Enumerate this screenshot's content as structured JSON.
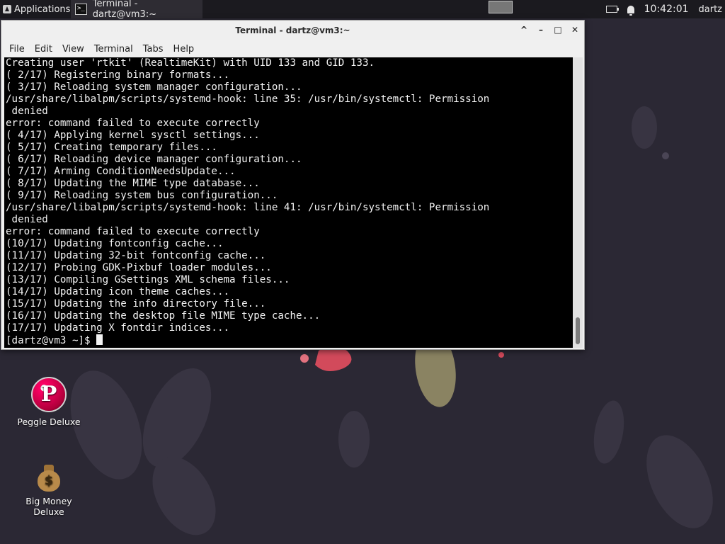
{
  "panel": {
    "applications_label": "Applications",
    "task_label": "Terminal - dartz@vm3:~",
    "task_icon_glyph": ">_",
    "clock": "10:42:01",
    "user": "dartz"
  },
  "window": {
    "title": "Terminal - dartz@vm3:~",
    "controls": {
      "shade": "^",
      "minimize": "–",
      "maximize": "□",
      "close": "✕"
    },
    "menu": [
      "File",
      "Edit",
      "View",
      "Terminal",
      "Tabs",
      "Help"
    ]
  },
  "terminal": {
    "lines": [
      "Creating user 'rtkit' (RealtimeKit) with UID 133 and GID 133.",
      "( 2/17) Registering binary formats...",
      "( 3/17) Reloading system manager configuration...",
      "/usr/share/libalpm/scripts/systemd-hook: line 35: /usr/bin/systemctl: Permission",
      " denied",
      "error: command failed to execute correctly",
      "( 4/17) Applying kernel sysctl settings...",
      "( 5/17) Creating temporary files...",
      "( 6/17) Reloading device manager configuration...",
      "( 7/17) Arming ConditionNeedsUpdate...",
      "( 8/17) Updating the MIME type database...",
      "( 9/17) Reloading system bus configuration...",
      "/usr/share/libalpm/scripts/systemd-hook: line 41: /usr/bin/systemctl: Permission",
      " denied",
      "error: command failed to execute correctly",
      "(10/17) Updating fontconfig cache...",
      "(11/17) Updating 32-bit fontconfig cache...",
      "(12/17) Probing GDK-Pixbuf loader modules...",
      "(13/17) Compiling GSettings XML schema files...",
      "(14/17) Updating icon theme caches...",
      "(15/17) Updating the info directory file...",
      "(16/17) Updating the desktop file MIME type cache...",
      "(17/17) Updating X fontdir indices..."
    ],
    "prompt": "[dartz@vm3 ~]$ "
  },
  "desktop": {
    "icons": [
      {
        "label": "Peggle Deluxe",
        "glyph": "P"
      },
      {
        "label": "Big Money Deluxe",
        "glyph": "$"
      }
    ]
  },
  "colors": {
    "desktop_bg": "#2b2834",
    "panel_bg": "#1b1a1f",
    "terminal_bg": "#000000",
    "terminal_fg": "#f2f2f2"
  }
}
